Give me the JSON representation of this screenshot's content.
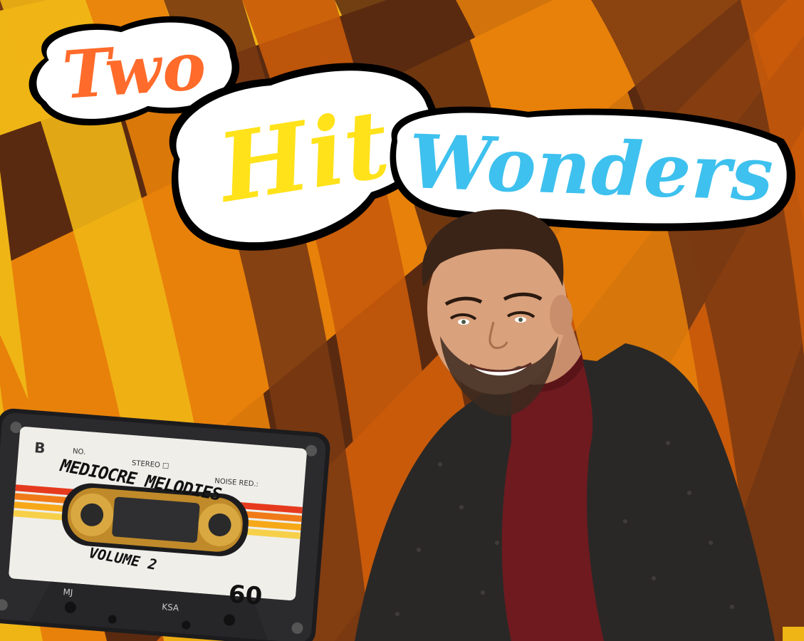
{
  "artwork": {
    "title_words": [
      "Two",
      "Hit",
      "Wonders"
    ],
    "title_colors": {
      "two": "#ff6b2b",
      "hit": "#ffe21a",
      "wonders": "#3ec1ee"
    },
    "background_palette": [
      "#7a3a12",
      "#c85a0a",
      "#e8810a",
      "#efb515",
      "#5a2a10"
    ],
    "cassette": {
      "side": "B",
      "no_label": "NO.",
      "stereo_label": "STEREO □",
      "noise_label": "NOISE RED.:",
      "handwritten_title": "MEDIOCRE MELODIES",
      "handwritten_subtitle": "VOLUME 2",
      "length": "60",
      "bottom_left_mark": "MJ",
      "bottom_right_mark": "KSA"
    },
    "person": {
      "sweater_color": "#2a2826",
      "turtleneck_color": "#6e1a1f"
    }
  }
}
